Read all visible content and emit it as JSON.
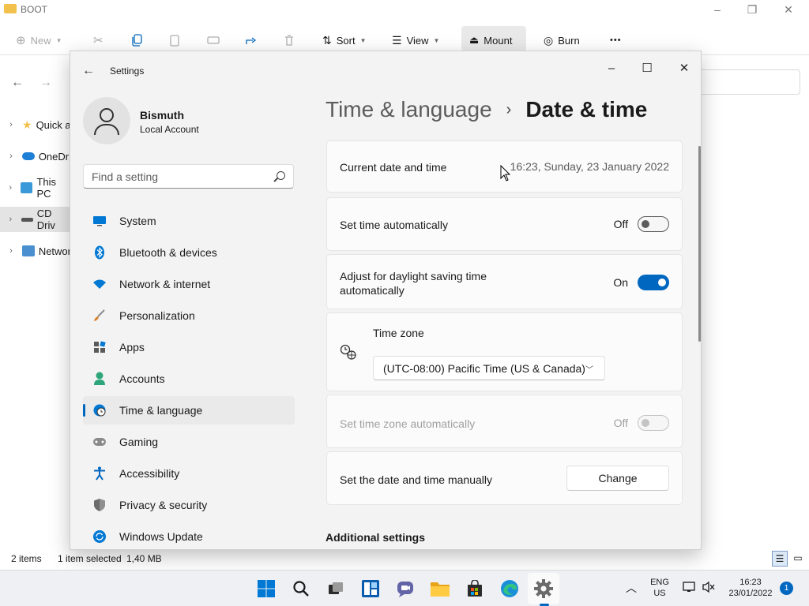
{
  "explorer": {
    "title": "BOOT",
    "toolbar": {
      "new": "New",
      "sort": "Sort",
      "view": "View",
      "mount": "Mount",
      "burn": "Burn",
      "more": "•••"
    },
    "tree": [
      {
        "label": "Quick a",
        "icon": "star-icon"
      },
      {
        "label": "OneDri",
        "icon": "cloud-icon"
      },
      {
        "label": "This PC",
        "icon": "monitor-icon"
      },
      {
        "label": "CD Driv",
        "icon": "drive-icon"
      },
      {
        "label": "Networ",
        "icon": "network-icon"
      }
    ],
    "status": {
      "items": "2 items",
      "selected": "1 item selected",
      "size": "1,40 MB"
    }
  },
  "settings": {
    "window_title": "Settings",
    "user": {
      "name": "Bismuth",
      "account_type": "Local Account"
    },
    "search_placeholder": "Find a setting",
    "nav": [
      {
        "label": "System",
        "icon": "monitor-icon",
        "color": "#0067c0"
      },
      {
        "label": "Bluetooth & devices",
        "icon": "bluetooth-icon",
        "color": "#0078d4"
      },
      {
        "label": "Network & internet",
        "icon": "wifi-icon",
        "color": "#0078d4"
      },
      {
        "label": "Personalization",
        "icon": "brush-icon",
        "color": "#d9822b"
      },
      {
        "label": "Apps",
        "icon": "apps-icon",
        "color": "#555555"
      },
      {
        "label": "Accounts",
        "icon": "person-icon",
        "color": "#2ea67a"
      },
      {
        "label": "Time & language",
        "icon": "globe-clock-icon",
        "color": "#0078d4",
        "active": true
      },
      {
        "label": "Gaming",
        "icon": "gamepad-icon",
        "color": "#777777"
      },
      {
        "label": "Accessibility",
        "icon": "accessibility-icon",
        "color": "#0067c0"
      },
      {
        "label": "Privacy & security",
        "icon": "shield-icon",
        "color": "#6b6b6b"
      },
      {
        "label": "Windows Update",
        "icon": "update-icon",
        "color": "#0078d4"
      }
    ],
    "breadcrumb": {
      "parent": "Time & language",
      "separator": "›",
      "current": "Date & time"
    },
    "cards": {
      "current_datetime": {
        "label": "Current date and time",
        "value": "16:23, Sunday, 23 January 2022"
      },
      "set_time_auto": {
        "label": "Set time automatically",
        "state": "Off"
      },
      "dst_auto": {
        "label_line1": "Adjust for daylight saving time",
        "label_line2": "automatically",
        "state": "On"
      },
      "time_zone": {
        "label": "Time zone",
        "selected": "(UTC-08:00) Pacific Time (US & Canada)"
      },
      "time_zone_auto": {
        "label": "Set time zone automatically",
        "state": "Off"
      },
      "manual": {
        "label": "Set the date and time manually",
        "button": "Change"
      }
    },
    "additional_heading": "Additional settings"
  },
  "taskbar": {
    "lang_top": "ENG",
    "lang_bottom": "US",
    "time": "16:23",
    "date": "23/01/2022",
    "notification_count": "1"
  },
  "colors": {
    "accent": "#0067c0",
    "card_bg": "#fbfbfb",
    "window_bg": "#f3f3f3"
  }
}
